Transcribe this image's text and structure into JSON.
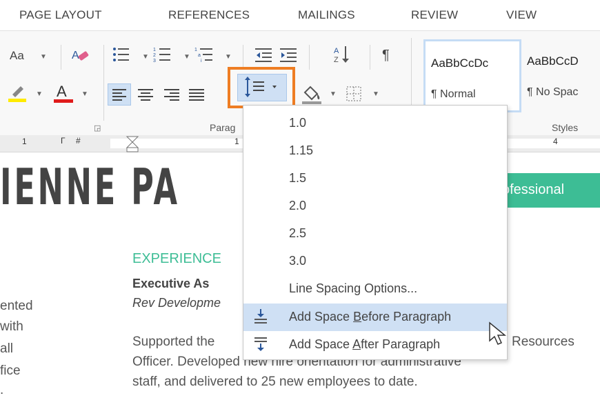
{
  "tabs": [
    "PAGE LAYOUT",
    "REFERENCES",
    "MAILINGS",
    "REVIEW",
    "VIEW"
  ],
  "ribbon": {
    "font_aa": "Aa",
    "para_label": "Parag",
    "styles_label": "Styles",
    "styles": [
      {
        "sample": "AaBbCcDc",
        "name": "¶ Normal"
      },
      {
        "sample": "AaBbCcD",
        "name": "¶ No Spac"
      }
    ]
  },
  "ruler": {
    "num1": "1",
    "num2": "1",
    "num4": "4"
  },
  "document": {
    "title": "IENNE PA",
    "banner": "ofessional",
    "section": "EXPERIENCE",
    "job_title": "Executive As",
    "company": "Rev Developme",
    "body_line1": "Supported the",
    "body_line1_end": "Resources",
    "body_line2": "Officer. Developed new hire orientation for administrative",
    "body_line3": "staff, and delivered to 25 new employees to date.",
    "left_fragments": [
      "ented",
      "with",
      "all",
      "fice",
      "."
    ]
  },
  "menu": {
    "items": [
      {
        "label": "1.0"
      },
      {
        "label": "1.15"
      },
      {
        "label": "1.5"
      },
      {
        "label": "2.0"
      },
      {
        "label": "2.5"
      },
      {
        "label": "3.0"
      },
      {
        "label": "Line Spacing Options..."
      }
    ],
    "add_before": {
      "pre": "Add Space ",
      "u": "B",
      "post": "efore Paragraph"
    },
    "add_after": {
      "pre": "Add Space ",
      "u": "A",
      "post": "fter Paragraph"
    }
  },
  "colors": {
    "accent_green": "#3dbd95",
    "highlight_orange": "#ee7d23",
    "hover_blue": "#cfe0f4"
  }
}
